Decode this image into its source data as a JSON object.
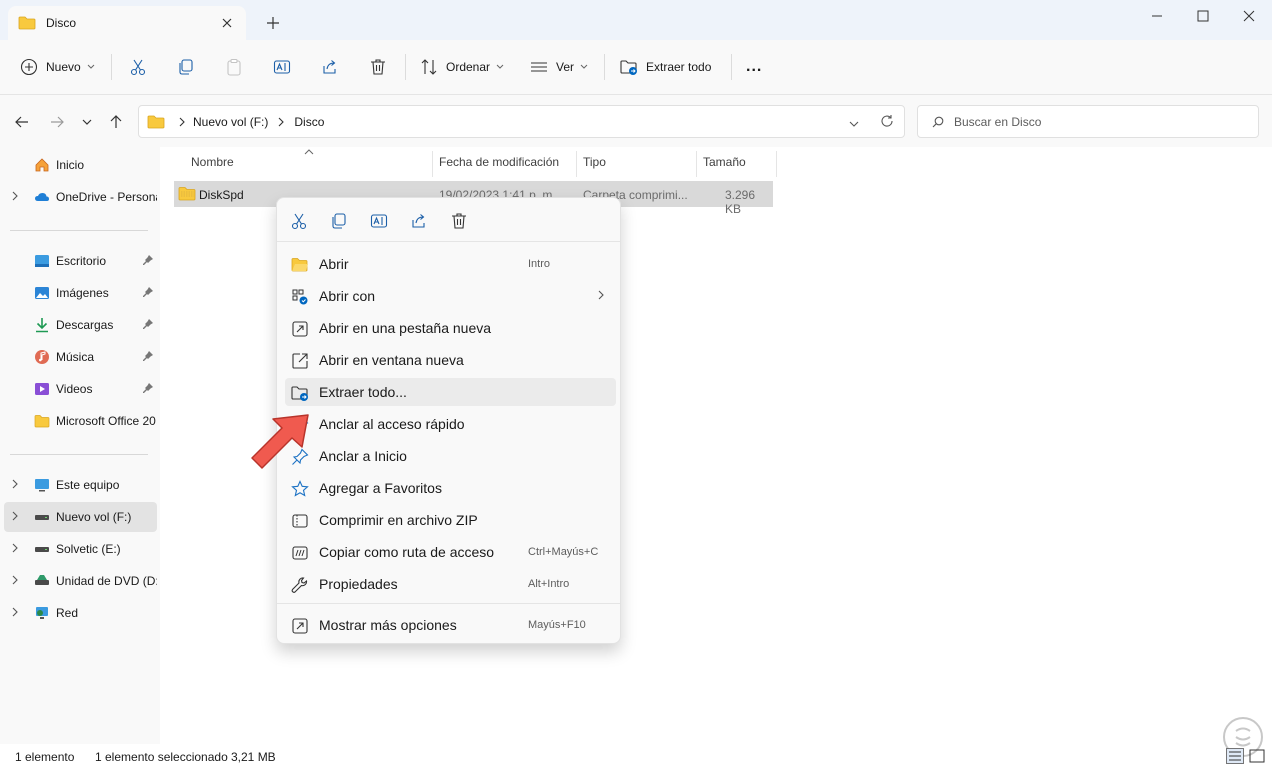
{
  "window": {
    "tab_title": "Disco",
    "new_tab": "+"
  },
  "toolbar": {
    "new_label": "Nuevo",
    "sort_label": "Ordenar",
    "view_label": "Ver",
    "extract_label": "Extraer todo",
    "more_label": "..."
  },
  "address": {
    "crumbs": [
      "Nuevo vol (F:)",
      "Disco"
    ],
    "search_placeholder": "Buscar en Disco"
  },
  "sidebar": {
    "items": [
      {
        "label": "Inicio"
      },
      {
        "label": "OneDrive - Persona"
      },
      {
        "label": "Escritorio"
      },
      {
        "label": "Imágenes"
      },
      {
        "label": "Descargas"
      },
      {
        "label": "Música"
      },
      {
        "label": "Videos"
      },
      {
        "label": "Microsoft Office 20"
      },
      {
        "label": "Este equipo"
      },
      {
        "label": "Nuevo vol (F:)"
      },
      {
        "label": "Solvetic (E:)"
      },
      {
        "label": "Unidad de DVD (D:)"
      },
      {
        "label": "Red"
      }
    ]
  },
  "columns": {
    "name": "Nombre",
    "modified": "Fecha de modificación",
    "type": "Tipo",
    "size": "Tamaño"
  },
  "files": [
    {
      "name": "DiskSpd",
      "modified": "19/02/2023 1:41 p. m.",
      "type": "Carpeta comprimi...",
      "size": "3.296 KB"
    }
  ],
  "context_menu": {
    "items": [
      {
        "label": "Abrir",
        "shortcut": "Intro"
      },
      {
        "label": "Abrir con",
        "shortcut": ""
      },
      {
        "label": "Abrir en una pestaña nueva",
        "shortcut": ""
      },
      {
        "label": "Abrir en ventana nueva",
        "shortcut": ""
      },
      {
        "label": "Extraer todo...",
        "shortcut": ""
      },
      {
        "label": "Anclar al acceso rápido",
        "shortcut": ""
      },
      {
        "label": "Anclar a Inicio",
        "shortcut": ""
      },
      {
        "label": "Agregar a Favoritos",
        "shortcut": ""
      },
      {
        "label": "Comprimir en archivo ZIP",
        "shortcut": ""
      },
      {
        "label": "Copiar como ruta de acceso",
        "shortcut": "Ctrl+Mayús+C"
      },
      {
        "label": "Propiedades",
        "shortcut": "Alt+Intro"
      },
      {
        "label": "Mostrar más opciones",
        "shortcut": "Mayús+F10"
      }
    ]
  },
  "status": {
    "count": "1 elemento",
    "selected": "1 elemento seleccionado",
    "size": "3,21 MB"
  },
  "colors": {
    "accent": "#0067c0",
    "folder": "#f8c93e",
    "arrow": "#f05a4f"
  }
}
